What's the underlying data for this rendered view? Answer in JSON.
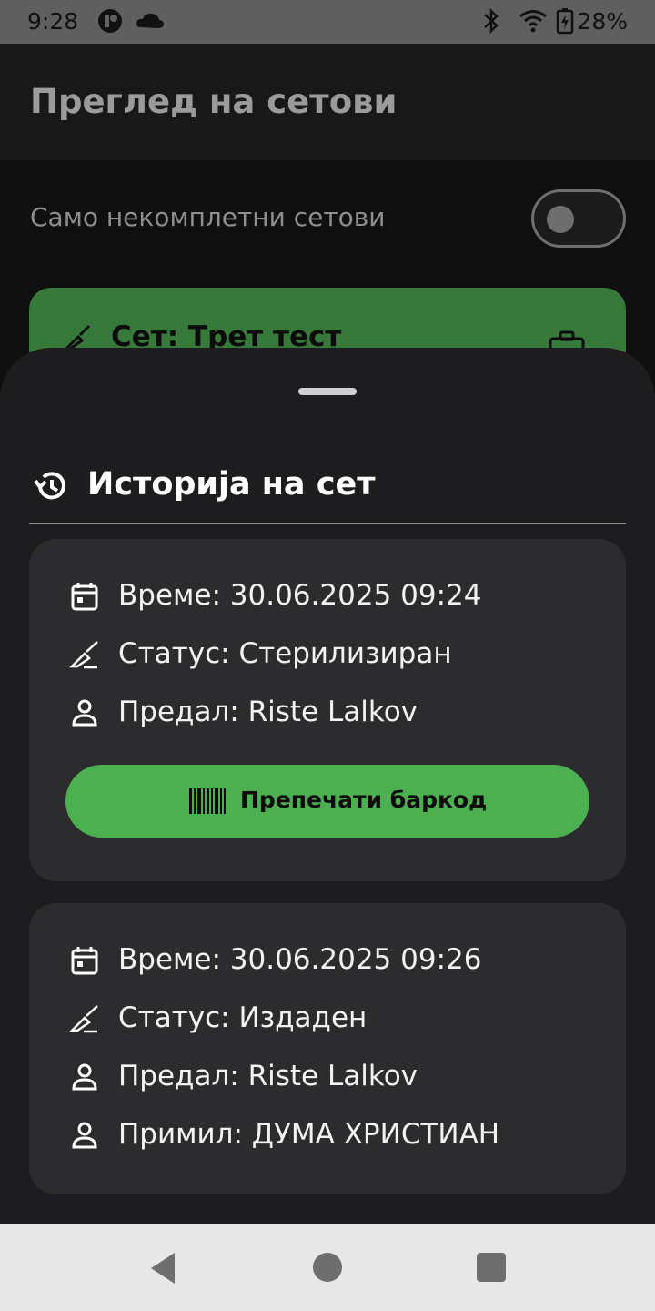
{
  "status_bar": {
    "time": "9:28",
    "battery": "28%",
    "icons": [
      "app-icon",
      "cloud-icon",
      "bluetooth-icon",
      "wifi-icon",
      "battery-charging-icon"
    ]
  },
  "app_bar": {
    "title": "Преглед на сетови"
  },
  "filter": {
    "label": "Само некомплетни сетови",
    "enabled": false
  },
  "set_card": {
    "title": "Сет: Трет тест",
    "color": "#37793a"
  },
  "history_sheet": {
    "title": "Историја на сет",
    "entries": [
      {
        "time": "Време: 30.06.2025 09:24",
        "status": "Статус: Стерилизиран",
        "handed_by": "Предал: Riste Lalkov",
        "button_label": "Препечати баркод"
      },
      {
        "time": "Време: 30.06.2025 09:26",
        "status": "Статус: Издаден",
        "handed_by": "Предал: Riste Lalkov",
        "received_by": "Примил: ДУМА ХРИСТИАН"
      }
    ]
  },
  "colors": {
    "accent_button": "#4caf50",
    "sheet_bg": "#1d1d1f",
    "card_bg": "#2c2c2e"
  }
}
